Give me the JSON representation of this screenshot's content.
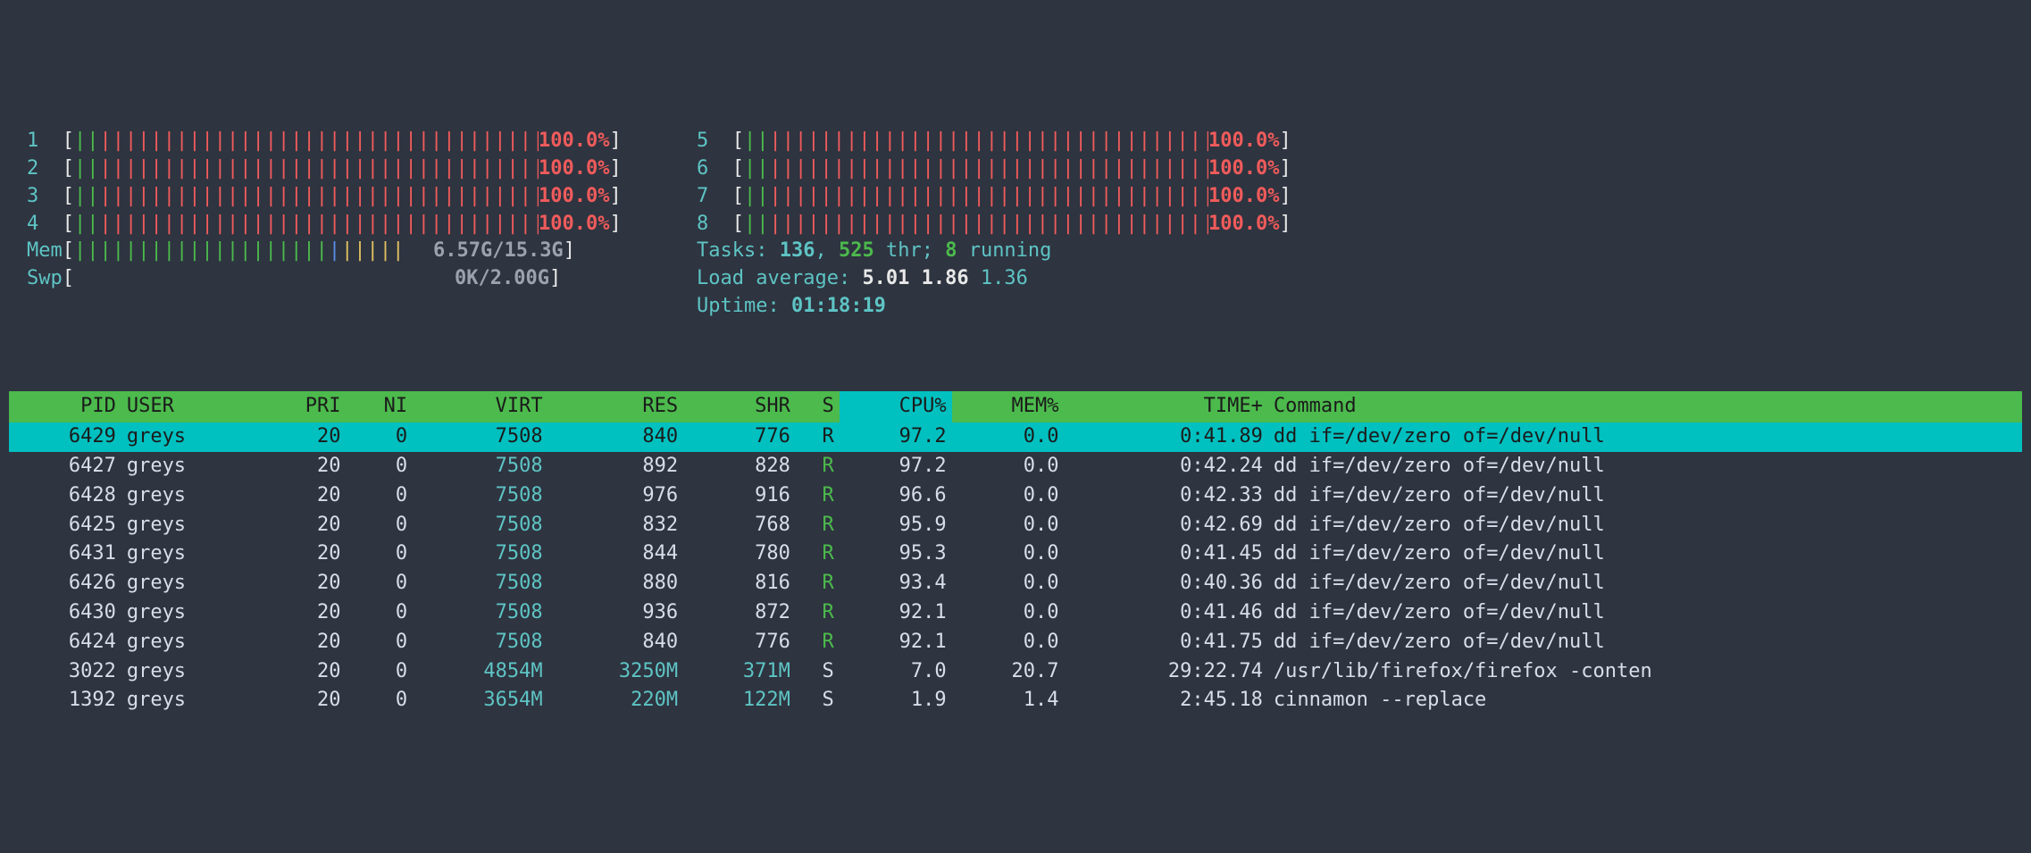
{
  "cpu_bars": {
    "left": [
      {
        "id": "1",
        "pct": "100.0%"
      },
      {
        "id": "2",
        "pct": "100.0%"
      },
      {
        "id": "3",
        "pct": "100.0%"
      },
      {
        "id": "4",
        "pct": "100.0%"
      }
    ],
    "right": [
      {
        "id": "5",
        "pct": "100.0%"
      },
      {
        "id": "6",
        "pct": "100.0%"
      },
      {
        "id": "7",
        "pct": "100.0%"
      },
      {
        "id": "8",
        "pct": "100.0%"
      }
    ]
  },
  "mem": {
    "label": "Mem",
    "text": "6.57G/15.3G"
  },
  "swp": {
    "label": "Swp",
    "text": "0K/2.00G"
  },
  "tasks": {
    "label": "Tasks:",
    "count": "136",
    "sep": ",",
    "thr": "525",
    "thr_label": "thr;",
    "running": "8",
    "running_label": "running"
  },
  "load": {
    "label": "Load average:",
    "v1": "5.01",
    "v2": "1.86",
    "v3": "1.36"
  },
  "uptime": {
    "label": "Uptime:",
    "value": "01:18:19"
  },
  "columns": [
    "PID",
    "USER",
    "PRI",
    "NI",
    "VIRT",
    "RES",
    "SHR",
    "S",
    "CPU%",
    "MEM%",
    "TIME+",
    "Command"
  ],
  "rows": [
    {
      "sel": true,
      "pid": "6429",
      "user": "greys",
      "pri": "20",
      "ni": "0",
      "virt": "7508",
      "res": "840",
      "shr": "776",
      "s": "R",
      "cpu": "97.2",
      "mem": "0.0",
      "time": "0:41.89",
      "cmd": "dd if=/dev/zero of=/dev/null",
      "virt_hl": false
    },
    {
      "pid": "6427",
      "user": "greys",
      "pri": "20",
      "ni": "0",
      "virt": "7508",
      "res": "892",
      "shr": "828",
      "s": "R",
      "cpu": "97.2",
      "mem": "0.0",
      "time": "0:42.24",
      "cmd": "dd if=/dev/zero of=/dev/null",
      "virt_hl": true
    },
    {
      "pid": "6428",
      "user": "greys",
      "pri": "20",
      "ni": "0",
      "virt": "7508",
      "res": "976",
      "shr": "916",
      "s": "R",
      "cpu": "96.6",
      "mem": "0.0",
      "time": "0:42.33",
      "cmd": "dd if=/dev/zero of=/dev/null",
      "virt_hl": true
    },
    {
      "pid": "6425",
      "user": "greys",
      "pri": "20",
      "ni": "0",
      "virt": "7508",
      "res": "832",
      "shr": "768",
      "s": "R",
      "cpu": "95.9",
      "mem": "0.0",
      "time": "0:42.69",
      "cmd": "dd if=/dev/zero of=/dev/null",
      "virt_hl": true
    },
    {
      "pid": "6431",
      "user": "greys",
      "pri": "20",
      "ni": "0",
      "virt": "7508",
      "res": "844",
      "shr": "780",
      "s": "R",
      "cpu": "95.3",
      "mem": "0.0",
      "time": "0:41.45",
      "cmd": "dd if=/dev/zero of=/dev/null",
      "virt_hl": true
    },
    {
      "pid": "6426",
      "user": "greys",
      "pri": "20",
      "ni": "0",
      "virt": "7508",
      "res": "880",
      "shr": "816",
      "s": "R",
      "cpu": "93.4",
      "mem": "0.0",
      "time": "0:40.36",
      "cmd": "dd if=/dev/zero of=/dev/null",
      "virt_hl": true
    },
    {
      "pid": "6430",
      "user": "greys",
      "pri": "20",
      "ni": "0",
      "virt": "7508",
      "res": "936",
      "shr": "872",
      "s": "R",
      "cpu": "92.1",
      "mem": "0.0",
      "time": "0:41.46",
      "cmd": "dd if=/dev/zero of=/dev/null",
      "virt_hl": true
    },
    {
      "pid": "6424",
      "user": "greys",
      "pri": "20",
      "ni": "0",
      "virt": "7508",
      "res": "840",
      "shr": "776",
      "s": "R",
      "cpu": "92.1",
      "mem": "0.0",
      "time": "0:41.75",
      "cmd": "dd if=/dev/zero of=/dev/null",
      "virt_hl": true
    },
    {
      "pid": "3022",
      "user": "greys",
      "pri": "20",
      "ni": "0",
      "virt": "4854M",
      "res": "3250M",
      "shr": "371M",
      "s": "S",
      "cpu": "7.0",
      "mem": "20.7",
      "time": "29:22.74",
      "cmd": "/usr/lib/firefox/firefox -conten",
      "virt_hl": true,
      "res_hl": true,
      "shr_hl": true
    },
    {
      "pid": "1392",
      "user": "greys",
      "pri": "20",
      "ni": "0",
      "virt": "3654M",
      "res": "220M",
      "shr": "122M",
      "s": "S",
      "cpu": "1.9",
      "mem": "1.4",
      "time": "2:45.18",
      "cmd": "cinnamon --replace",
      "virt_hl": true,
      "res_hl": true,
      "shr_hl": true
    }
  ]
}
